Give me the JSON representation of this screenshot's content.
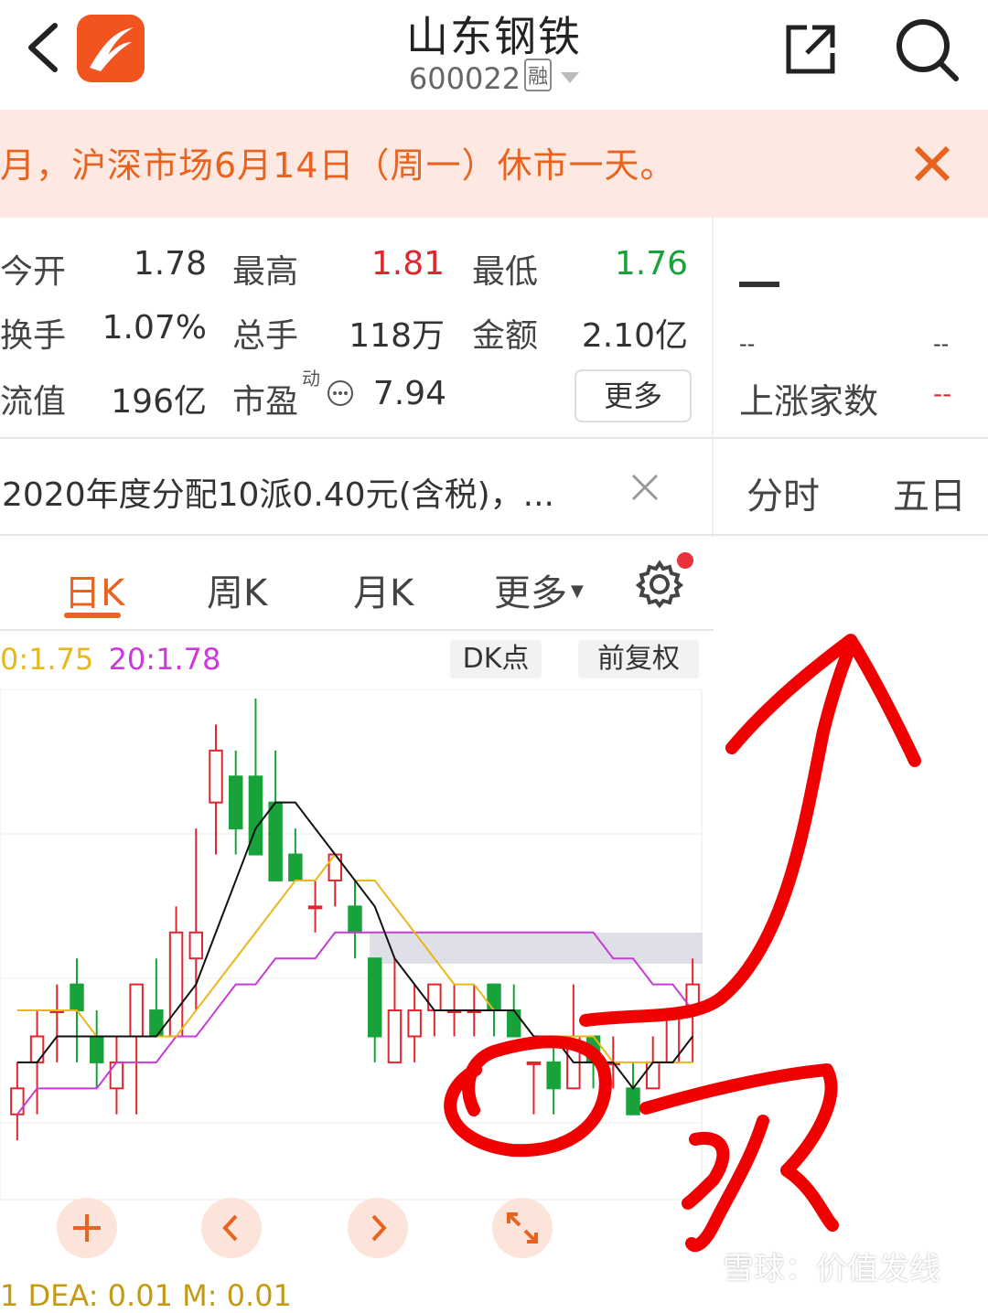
{
  "header": {
    "title": "山东钢铁",
    "code": "600022",
    "margin_badge": "融"
  },
  "notice": {
    "text": "月，沪深市场6月14日（周一）休市一天。"
  },
  "quote": {
    "open_label": "今开",
    "open": "1.78",
    "high_label": "最高",
    "high": "1.81",
    "low_label": "最低",
    "low": "1.76",
    "turnover_label": "换手",
    "turnover": "1.07%",
    "volume_label": "总手",
    "volume": "118万",
    "amount_label": "金额",
    "amount": "2.10亿",
    "float_mv_label": "流值",
    "float_mv": "196亿",
    "pe_label": "市盈",
    "pe_sup": "动",
    "pe": "7.94",
    "more_label": "更多"
  },
  "right_panel": {
    "price_dash": "--",
    "dash_a": "--",
    "dash_b": "--",
    "rise_label": "上涨家数",
    "rise_value": "--",
    "tabs": [
      "分时",
      "五日"
    ]
  },
  "dividend": {
    "text": "2020年度分配10派0.40元(含税)，..."
  },
  "ktabs": {
    "day": "日K",
    "week": "周K",
    "month": "月K",
    "more": "更多"
  },
  "ma": {
    "ma10": "0:1.75",
    "ma20": "20:1.78",
    "dk_label": "DK点",
    "adjust_label": "前复权"
  },
  "bottom_indicator": {
    "dea": "1  DEA: 0.01  M: 0.01"
  },
  "watermark": "雪球：价值发线",
  "colors": {
    "accent": "#e8631f",
    "up": "#e0262f",
    "down": "#18a33a",
    "ma5": "#000000",
    "ma10": "#e8b81a",
    "ma20": "#c93ad8"
  },
  "chart_data": {
    "type": "candlestick",
    "title": "",
    "ylim": [
      1.67,
      1.86
    ],
    "candles": [
      {
        "o": 1.7,
        "c": 1.71,
        "h": 1.72,
        "l": 1.69
      },
      {
        "o": 1.72,
        "c": 1.73,
        "h": 1.74,
        "l": 1.7
      },
      {
        "o": 1.74,
        "c": 1.74,
        "h": 1.75,
        "l": 1.72
      },
      {
        "o": 1.75,
        "c": 1.74,
        "h": 1.76,
        "l": 1.72
      },
      {
        "o": 1.73,
        "c": 1.72,
        "h": 1.74,
        "l": 1.71
      },
      {
        "o": 1.71,
        "c": 1.72,
        "h": 1.73,
        "l": 1.7
      },
      {
        "o": 1.73,
        "c": 1.75,
        "h": 1.75,
        "l": 1.7
      },
      {
        "o": 1.74,
        "c": 1.73,
        "h": 1.76,
        "l": 1.73
      },
      {
        "o": 1.73,
        "c": 1.77,
        "h": 1.78,
        "l": 1.73
      },
      {
        "o": 1.76,
        "c": 1.77,
        "h": 1.81,
        "l": 1.74
      },
      {
        "o": 1.82,
        "c": 1.84,
        "h": 1.85,
        "l": 1.8
      },
      {
        "o": 1.83,
        "c": 1.81,
        "h": 1.84,
        "l": 1.8
      },
      {
        "o": 1.83,
        "c": 1.8,
        "h": 1.86,
        "l": 1.8
      },
      {
        "o": 1.82,
        "c": 1.79,
        "h": 1.84,
        "l": 1.79
      },
      {
        "o": 1.8,
        "c": 1.79,
        "h": 1.81,
        "l": 1.79
      },
      {
        "o": 1.78,
        "c": 1.78,
        "h": 1.79,
        "l": 1.77
      },
      {
        "o": 1.79,
        "c": 1.8,
        "h": 1.8,
        "l": 1.78
      },
      {
        "o": 1.78,
        "c": 1.77,
        "h": 1.79,
        "l": 1.76
      },
      {
        "o": 1.76,
        "c": 1.73,
        "h": 1.76,
        "l": 1.72
      },
      {
        "o": 1.72,
        "c": 1.74,
        "h": 1.76,
        "l": 1.72
      },
      {
        "o": 1.73,
        "c": 1.74,
        "h": 1.75,
        "l": 1.72
      },
      {
        "o": 1.74,
        "c": 1.75,
        "h": 1.75,
        "l": 1.73
      },
      {
        "o": 1.74,
        "c": 1.74,
        "h": 1.75,
        "l": 1.73
      },
      {
        "o": 1.74,
        "c": 1.74,
        "h": 1.75,
        "l": 1.73
      },
      {
        "o": 1.75,
        "c": 1.74,
        "h": 1.75,
        "l": 1.73
      },
      {
        "o": 1.74,
        "c": 1.73,
        "h": 1.75,
        "l": 1.73
      },
      {
        "o": 1.72,
        "c": 1.72,
        "h": 1.72,
        "l": 1.7
      },
      {
        "o": 1.72,
        "c": 1.71,
        "h": 1.73,
        "l": 1.7
      },
      {
        "o": 1.71,
        "c": 1.73,
        "h": 1.75,
        "l": 1.71
      },
      {
        "o": 1.73,
        "c": 1.72,
        "h": 1.73,
        "l": 1.71
      },
      {
        "o": 1.72,
        "c": 1.72,
        "h": 1.73,
        "l": 1.71
      },
      {
        "o": 1.71,
        "c": 1.7,
        "h": 1.72,
        "l": 1.7
      },
      {
        "o": 1.71,
        "c": 1.72,
        "h": 1.73,
        "l": 1.71
      },
      {
        "o": 1.72,
        "c": 1.74,
        "h": 1.74,
        "l": 1.72
      },
      {
        "o": 1.74,
        "c": 1.75,
        "h": 1.76,
        "l": 1.72
      }
    ],
    "ma5": [
      1.72,
      1.72,
      1.73,
      1.73,
      1.73,
      1.73,
      1.73,
      1.73,
      1.74,
      1.75,
      1.77,
      1.79,
      1.81,
      1.82,
      1.82,
      1.81,
      1.8,
      1.79,
      1.78,
      1.76,
      1.75,
      1.74,
      1.74,
      1.74,
      1.74,
      1.74,
      1.73,
      1.73,
      1.72,
      1.72,
      1.72,
      1.71,
      1.72,
      1.72,
      1.73
    ],
    "ma10": [
      1.74,
      1.74,
      1.74,
      1.74,
      1.73,
      1.73,
      1.73,
      1.73,
      1.73,
      1.74,
      1.75,
      1.76,
      1.77,
      1.78,
      1.79,
      1.79,
      1.8,
      1.79,
      1.79,
      1.78,
      1.77,
      1.76,
      1.75,
      1.75,
      1.74,
      1.74,
      1.73,
      1.73,
      1.73,
      1.73,
      1.72,
      1.72,
      1.72,
      1.72,
      1.72
    ],
    "ma20": [
      1.7,
      1.71,
      1.71,
      1.71,
      1.71,
      1.72,
      1.72,
      1.72,
      1.73,
      1.73,
      1.74,
      1.75,
      1.75,
      1.76,
      1.76,
      1.76,
      1.77,
      1.77,
      1.77,
      1.77,
      1.77,
      1.77,
      1.77,
      1.77,
      1.77,
      1.77,
      1.77,
      1.77,
      1.77,
      1.77,
      1.76,
      1.76,
      1.75,
      1.75,
      1.74
    ]
  }
}
